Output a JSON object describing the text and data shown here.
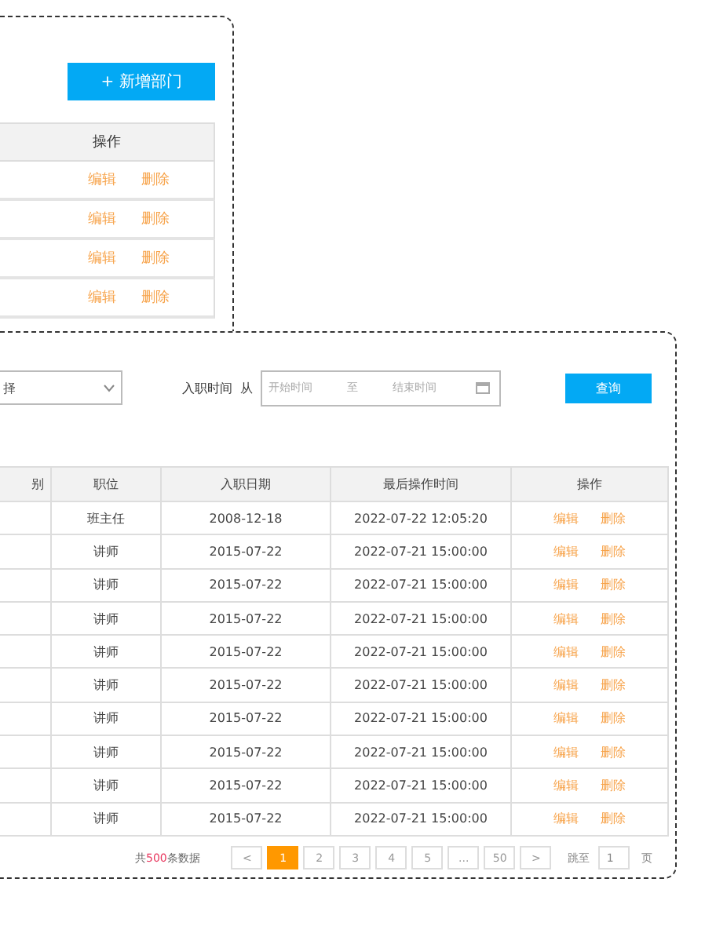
{
  "department_panel": {
    "add_button": "+ 新增部门",
    "table": {
      "columns": [
        "操作"
      ],
      "rows": [
        {
          "actions": [
            "编辑",
            "删除"
          ]
        },
        {
          "actions": [
            "编辑",
            "删除"
          ]
        },
        {
          "actions": [
            "编辑",
            "删除"
          ]
        },
        {
          "actions": [
            "编辑",
            "删除"
          ]
        }
      ]
    }
  },
  "employee_panel": {
    "filters": {
      "select_value": "择",
      "date_label": "入职时间  从",
      "start_placeholder": "开始时间",
      "separator": "至",
      "end_placeholder": "结束时间",
      "query_button": "查询"
    },
    "table": {
      "columns": [
        "别",
        "职位",
        "入职日期",
        "最后操作时间",
        "操作"
      ],
      "rows": [
        {
          "position": "班主任",
          "hire_date": "2008-12-18",
          "last_modified": "2022-07-22 12:05:20",
          "actions": [
            "编辑",
            "删除"
          ]
        },
        {
          "position": "讲师",
          "hire_date": "2015-07-22",
          "last_modified": "2022-07-21 15:00:00",
          "actions": [
            "编辑",
            "删除"
          ]
        },
        {
          "position": "讲师",
          "hire_date": "2015-07-22",
          "last_modified": "2022-07-21 15:00:00",
          "actions": [
            "编辑",
            "删除"
          ]
        },
        {
          "position": "讲师",
          "hire_date": "2015-07-22",
          "last_modified": "2022-07-21 15:00:00",
          "actions": [
            "编辑",
            "删除"
          ]
        },
        {
          "position": "讲师",
          "hire_date": "2015-07-22",
          "last_modified": "2022-07-21 15:00:00",
          "actions": [
            "编辑",
            "删除"
          ]
        },
        {
          "position": "讲师",
          "hire_date": "2015-07-22",
          "last_modified": "2022-07-21 15:00:00",
          "actions": [
            "编辑",
            "删除"
          ]
        },
        {
          "position": "讲师",
          "hire_date": "2015-07-22",
          "last_modified": "2022-07-21 15:00:00",
          "actions": [
            "编辑",
            "删除"
          ]
        },
        {
          "position": "讲师",
          "hire_date": "2015-07-22",
          "last_modified": "2022-07-21 15:00:00",
          "actions": [
            "编辑",
            "删除"
          ]
        },
        {
          "position": "讲师",
          "hire_date": "2015-07-22",
          "last_modified": "2022-07-21 15:00:00",
          "actions": [
            "编辑",
            "删除"
          ]
        },
        {
          "position": "讲师",
          "hire_date": "2015-07-22",
          "last_modified": "2022-07-21 15:00:00",
          "actions": [
            "编辑",
            "删除"
          ]
        }
      ]
    },
    "pagination": {
      "total_prefix": "共",
      "total_count": "500",
      "total_suffix": "条数据",
      "pages": [
        {
          "label": "<",
          "selected": false
        },
        {
          "label": "1",
          "selected": true
        },
        {
          "label": "2",
          "selected": false
        },
        {
          "label": "3",
          "selected": false
        },
        {
          "label": "4",
          "selected": false
        },
        {
          "label": "5",
          "selected": false
        },
        {
          "label": "...",
          "selected": false
        },
        {
          "label": "50",
          "selected": false
        },
        {
          "label": ">",
          "selected": false
        }
      ],
      "jump_label": "跳至",
      "jump_value": "1",
      "page_suffix": "页"
    }
  }
}
